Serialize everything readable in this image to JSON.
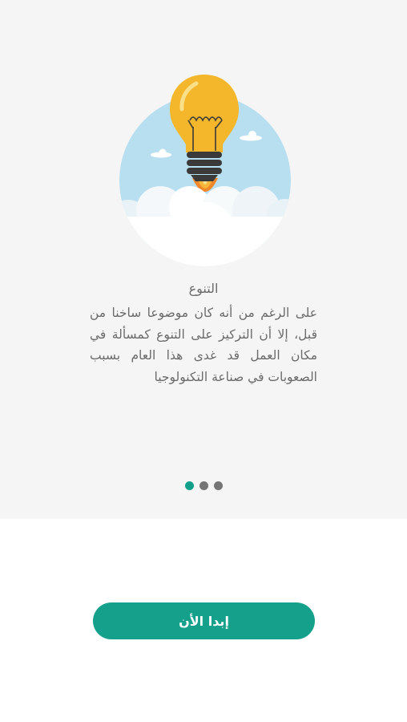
{
  "slide": {
    "title": "التنوع",
    "body": "على الرغم من أنه كان موضوعا ساخنا من قبل، إلا أن التركيز على التنوع كمسألة في مكان العمل قد غدى هذا العام بسبب الصعوبات في صناعة التكنولوجيا",
    "illustration_icon": "lightbulb-rocket-icon"
  },
  "pagination": {
    "total": 3,
    "active_index": 0
  },
  "actions": {
    "start_label": "إبدا الأن"
  },
  "colors": {
    "accent": "#14a08b",
    "panel_background": "#f5f5f5",
    "text": "#6a6a6a",
    "dot_inactive": "#757575",
    "sky": "#b8dff0",
    "bulb": "#f4b62b"
  }
}
